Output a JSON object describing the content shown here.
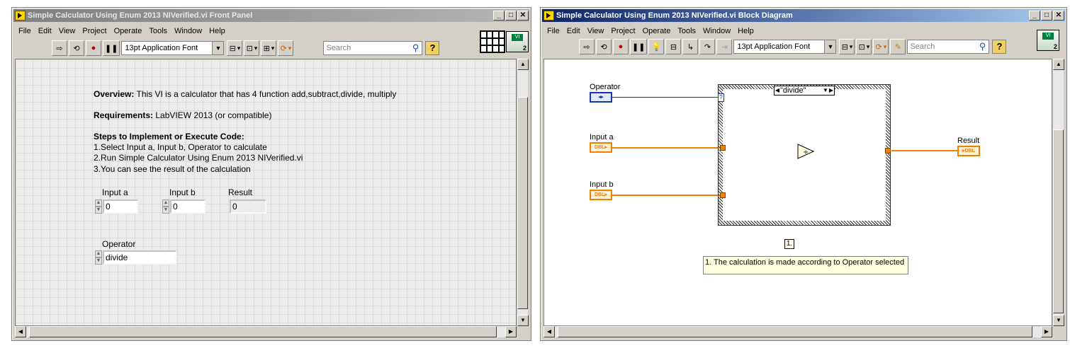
{
  "front_panel": {
    "title": "Simple Calculator Using Enum 2013 NIVerified.vi Front Panel",
    "menu": [
      "File",
      "Edit",
      "View",
      "Project",
      "Operate",
      "Tools",
      "Window",
      "Help"
    ],
    "font": "13pt Application Font",
    "search_placeholder": "Search",
    "help": "?",
    "icon_badge": "2",
    "overview_label": "Overview:",
    "overview_text": " This VI is a calculator that has 4 function add,subtract,divide, multiply",
    "requirements_label": "Requirements:",
    "requirements_text": " LabVIEW 2013 (or compatible)",
    "steps_heading": "Steps to Implement or Execute Code:",
    "step1": "1.Select Input a, Input b, Operator to calculate",
    "step2": "2.Run Simple Calculator Using Enum 2013 NIVerified.vi",
    "step3": "3.You can see the result of the calculation",
    "controls": {
      "input_a": {
        "label": "Input a",
        "value": "0"
      },
      "input_b": {
        "label": "Input b",
        "value": "0"
      },
      "result": {
        "label": "Result",
        "value": "0"
      },
      "operator": {
        "label": "Operator",
        "value": "divide"
      }
    }
  },
  "block_diagram": {
    "title": "Simple Calculator Using Enum 2013 NIVerified.vi Block Diagram",
    "menu": [
      "File",
      "Edit",
      "View",
      "Project",
      "Operate",
      "Tools",
      "Window",
      "Help"
    ],
    "font": "13pt Application Font",
    "search_placeholder": "Search",
    "help": "?",
    "icon_badge": "2",
    "operator_label": "Operator",
    "input_a_label": "Input a",
    "input_b_label": "Input b",
    "result_label": "Result",
    "dbl": "DBL",
    "case_value": "\"divide\"",
    "selector_mark": "?",
    "divide_symbol": "÷",
    "seq_label": "1.",
    "comment": "1. The calculation is made according to Operator selected"
  }
}
